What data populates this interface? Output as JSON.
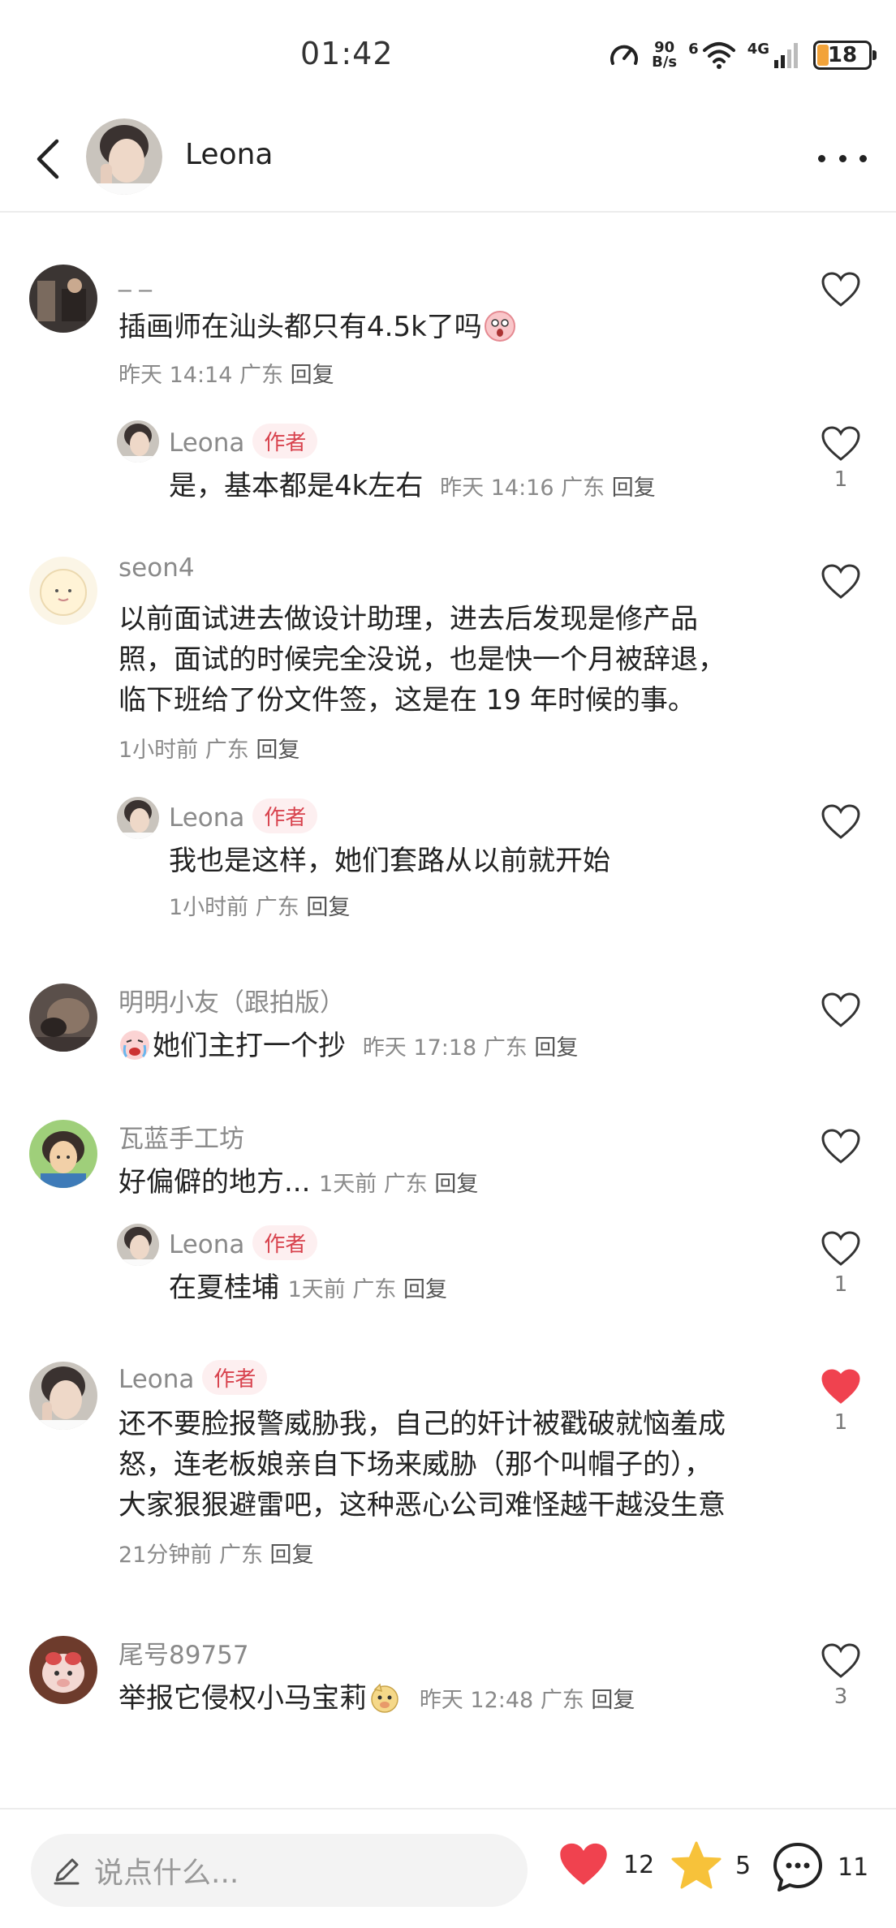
{
  "status_bar": {
    "time": "01:42",
    "net_speed_value": "90",
    "net_speed_unit": "B/s",
    "wifi_label": "6",
    "signal_label": "4G",
    "battery": "18"
  },
  "header": {
    "title": "Leona"
  },
  "comments": [
    {
      "username": "_ _",
      "text": "插画师在汕头都只有4.5k了吗",
      "meta_time": "昨天 14:14",
      "meta_region": "广东",
      "reply": "回复",
      "likes": "",
      "replies": [
        {
          "username": "Leona",
          "author_tag": "作者",
          "text": "是，基本都是4k左右",
          "meta_time": "昨天 14:16",
          "meta_region": "广东",
          "reply": "回复",
          "likes": "1"
        }
      ]
    },
    {
      "username": "seon4",
      "text_lines": [
        "以前面试进去做设计助理，进去后发现是修产品",
        "照，面试的时候完全没说，也是快一个月被辞退，",
        "临下班给了份文件签，这是在 19 年时候的事。"
      ],
      "meta_time": "1小时前",
      "meta_region": "广东",
      "reply": "回复",
      "likes": "",
      "replies": [
        {
          "username": "Leona",
          "author_tag": "作者",
          "text": "我也是这样，她们套路从以前就开始",
          "meta_time": "1小时前",
          "meta_region": "广东",
          "reply": "回复",
          "likes": ""
        }
      ]
    },
    {
      "username": "明明小友（跟拍版）",
      "text": "她们主打一个抄",
      "meta_time": "昨天 17:18",
      "meta_region": "广东",
      "reply": "回复",
      "likes": ""
    },
    {
      "username": "瓦蓝手工坊",
      "text": "好偏僻的地方...",
      "meta_time": "1天前",
      "meta_region": "广东",
      "reply": "回复",
      "likes": "",
      "replies": [
        {
          "username": "Leona",
          "author_tag": "作者",
          "text": "在夏桂埔",
          "meta_time": "1天前",
          "meta_region": "广东",
          "reply": "回复",
          "likes": "1"
        }
      ]
    },
    {
      "username": "Leona",
      "author_tag": "作者",
      "text_lines": [
        "还不要脸报警威胁我，自己的奸计被戳破就恼羞成",
        "怒，连老板娘亲自下场来威胁（那个叫帽子的），",
        "大家狠狠避雷吧，这种恶心公司难怪越干越没生意"
      ],
      "meta_time": "21分钟前",
      "meta_region": "广东",
      "reply": "回复",
      "likes": "1",
      "liked": true
    },
    {
      "username": "尾号89757",
      "text": "举报它侵权小马宝莉",
      "meta_time": "昨天 12:48",
      "meta_region": "广东",
      "reply": "回复",
      "likes": "3"
    }
  ],
  "bottom_bar": {
    "placeholder": "说点什么...",
    "like_count": "12",
    "star_count": "5",
    "comment_count": "11"
  },
  "colors": {
    "accent_red": "#f0424f",
    "author_tag_bg": "#fdeff0",
    "author_tag_text": "#d8434e",
    "star_yellow": "#f7c23a"
  }
}
